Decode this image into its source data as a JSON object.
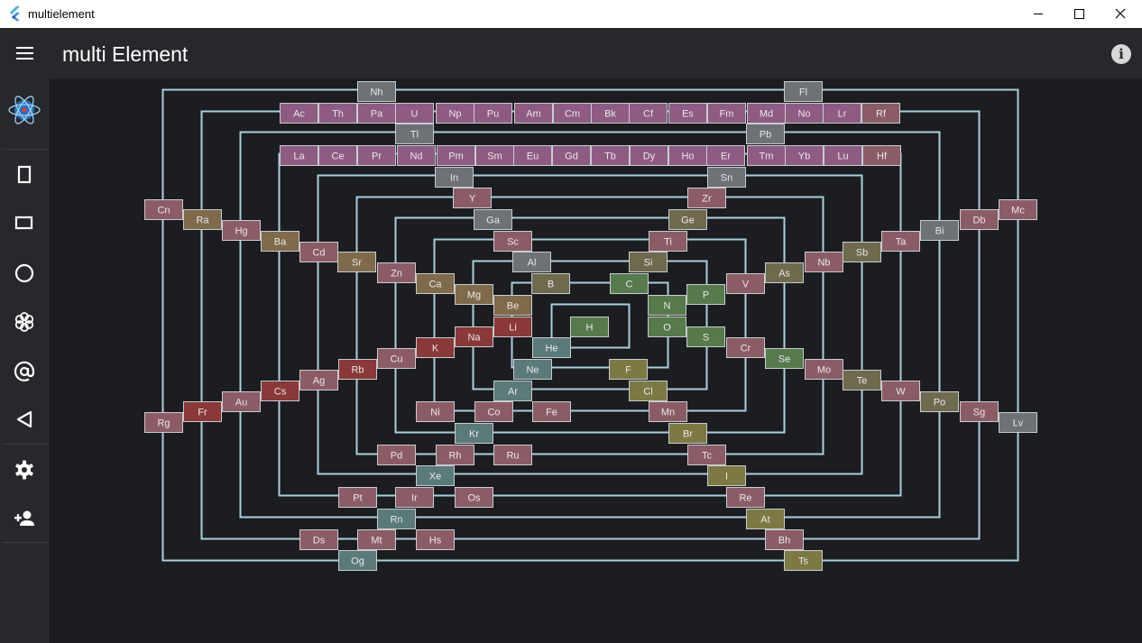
{
  "window": {
    "title": "multielement",
    "controls": [
      "minimize",
      "maximize",
      "close"
    ]
  },
  "appbar": {
    "title": "multi Element",
    "menu_icon": "menu-icon",
    "info_icon": "info-icon",
    "info_glyph": "i"
  },
  "rail": {
    "items": [
      {
        "name": "atom-logo",
        "icon": "atom-icon"
      },
      {
        "name": "portrait",
        "icon": "portrait-rect-icon"
      },
      {
        "name": "landscape",
        "icon": "landscape-rect-icon"
      },
      {
        "name": "circle",
        "icon": "circle-icon"
      },
      {
        "name": "flower",
        "icon": "flower-icon"
      },
      {
        "name": "spiral",
        "icon": "at-sign-icon"
      },
      {
        "name": "triangle",
        "icon": "triangle-icon"
      },
      {
        "name": "settings",
        "icon": "gear-icon"
      },
      {
        "name": "add-person",
        "icon": "add-person-icon"
      }
    ]
  },
  "colors": {
    "titlebar": "#ffffff",
    "appbar": "#26282b",
    "background": "#1c1d20",
    "wire": "#a9cfe0",
    "cell_border": "#c8ccd0",
    "text": "#e8e8e8",
    "lanthanide": "#8e5b83",
    "transition": "#8c5c66",
    "post_transition": "#6e7175",
    "metalloid": "#6f6a4e",
    "alkaline_earth": "#7f6a4a",
    "alkali": "#8a3838",
    "nonmetal": "#577a4c",
    "halogen": "#7c7a42",
    "noble_gas": "#5b7a7a"
  },
  "elements": [
    [
      "Nh",
      "post_transition"
    ],
    [
      "Fl",
      "post_transition"
    ],
    [
      "Ac",
      "lanthanide"
    ],
    [
      "Th",
      "lanthanide"
    ],
    [
      "Pa",
      "lanthanide"
    ],
    [
      "U",
      "lanthanide"
    ],
    [
      "Np",
      "lanthanide"
    ],
    [
      "Pu",
      "lanthanide"
    ],
    [
      "Am",
      "lanthanide"
    ],
    [
      "Cm",
      "lanthanide"
    ],
    [
      "Bk",
      "lanthanide"
    ],
    [
      "Cf",
      "lanthanide"
    ],
    [
      "Es",
      "lanthanide"
    ],
    [
      "Fm",
      "lanthanide"
    ],
    [
      "Md",
      "lanthanide"
    ],
    [
      "No",
      "lanthanide"
    ],
    [
      "Lr",
      "lanthanide"
    ],
    [
      "Rf",
      "transition"
    ],
    [
      "Tl",
      "post_transition"
    ],
    [
      "Pb",
      "post_transition"
    ],
    [
      "La",
      "lanthanide"
    ],
    [
      "Ce",
      "lanthanide"
    ],
    [
      "Pr",
      "lanthanide"
    ],
    [
      "Nd",
      "lanthanide"
    ],
    [
      "Pm",
      "lanthanide"
    ],
    [
      "Sm",
      "lanthanide"
    ],
    [
      "Eu",
      "lanthanide"
    ],
    [
      "Gd",
      "lanthanide"
    ],
    [
      "Tb",
      "lanthanide"
    ],
    [
      "Dy",
      "lanthanide"
    ],
    [
      "Ho",
      "lanthanide"
    ],
    [
      "Er",
      "lanthanide"
    ],
    [
      "Tm",
      "lanthanide"
    ],
    [
      "Yb",
      "lanthanide"
    ],
    [
      "Lu",
      "lanthanide"
    ],
    [
      "Hf",
      "transition"
    ],
    [
      "In",
      "post_transition"
    ],
    [
      "Sn",
      "post_transition"
    ],
    [
      "Y",
      "transition"
    ],
    [
      "Zr",
      "transition"
    ],
    [
      "Cn",
      "transition"
    ],
    [
      "Mc",
      "transition"
    ],
    [
      "Ra",
      "alkaline_earth"
    ],
    [
      "Db",
      "transition"
    ],
    [
      "Ga",
      "post_transition"
    ],
    [
      "Ge",
      "metalloid"
    ],
    [
      "Hg",
      "transition"
    ],
    [
      "Bi",
      "post_transition"
    ],
    [
      "Ba",
      "alkaline_earth"
    ],
    [
      "Ta",
      "transition"
    ],
    [
      "Sc",
      "transition"
    ],
    [
      "Ti",
      "transition"
    ],
    [
      "Cd",
      "transition"
    ],
    [
      "Sb",
      "metalloid"
    ],
    [
      "Sr",
      "alkaline_earth"
    ],
    [
      "Nb",
      "transition"
    ],
    [
      "Al",
      "post_transition"
    ],
    [
      "Si",
      "metalloid"
    ],
    [
      "Zn",
      "transition"
    ],
    [
      "As",
      "metalloid"
    ],
    [
      "B",
      "metalloid"
    ],
    [
      "C",
      "nonmetal"
    ],
    [
      "Ca",
      "alkaline_earth"
    ],
    [
      "V",
      "transition"
    ],
    [
      "Mg",
      "alkaline_earth"
    ],
    [
      "P",
      "nonmetal"
    ],
    [
      "Be",
      "alkaline_earth"
    ],
    [
      "N",
      "nonmetal"
    ],
    [
      "Li",
      "alkali"
    ],
    [
      "H",
      "nonmetal"
    ],
    [
      "O",
      "nonmetal"
    ],
    [
      "Na",
      "alkali"
    ],
    [
      "S",
      "nonmetal"
    ],
    [
      "He",
      "noble_gas"
    ],
    [
      "K",
      "alkali"
    ],
    [
      "Cr",
      "transition"
    ],
    [
      "Cu",
      "transition"
    ],
    [
      "Se",
      "nonmetal"
    ],
    [
      "Rb",
      "alkali"
    ],
    [
      "Ne",
      "noble_gas"
    ],
    [
      "F",
      "halogen"
    ],
    [
      "Mo",
      "transition"
    ],
    [
      "Ag",
      "transition"
    ],
    [
      "Te",
      "metalloid"
    ],
    [
      "Ar",
      "noble_gas"
    ],
    [
      "Cl",
      "halogen"
    ],
    [
      "Cs",
      "alkali"
    ],
    [
      "W",
      "transition"
    ],
    [
      "Au",
      "transition"
    ],
    [
      "Po",
      "metalloid"
    ],
    [
      "Fr",
      "alkali"
    ],
    [
      "Sg",
      "transition"
    ],
    [
      "Ni",
      "transition"
    ],
    [
      "Co",
      "transition"
    ],
    [
      "Fe",
      "transition"
    ],
    [
      "Mn",
      "transition"
    ],
    [
      "Rg",
      "transition"
    ],
    [
      "Lv",
      "post_transition"
    ],
    [
      "Kr",
      "noble_gas"
    ],
    [
      "Br",
      "halogen"
    ],
    [
      "Pd",
      "transition"
    ],
    [
      "Rh",
      "transition"
    ],
    [
      "Ru",
      "transition"
    ],
    [
      "Tc",
      "transition"
    ],
    [
      "Xe",
      "noble_gas"
    ],
    [
      "I",
      "halogen"
    ],
    [
      "Pt",
      "transition"
    ],
    [
      "Ir",
      "transition"
    ],
    [
      "Os",
      "transition"
    ],
    [
      "Re",
      "transition"
    ],
    [
      "Rn",
      "noble_gas"
    ],
    [
      "At",
      "halogen"
    ],
    [
      "Ds",
      "transition"
    ],
    [
      "Mt",
      "transition"
    ],
    [
      "Hs",
      "transition"
    ],
    [
      "Bh",
      "transition"
    ],
    [
      "Og",
      "noble_gas"
    ],
    [
      "Ts",
      "halogen"
    ]
  ]
}
